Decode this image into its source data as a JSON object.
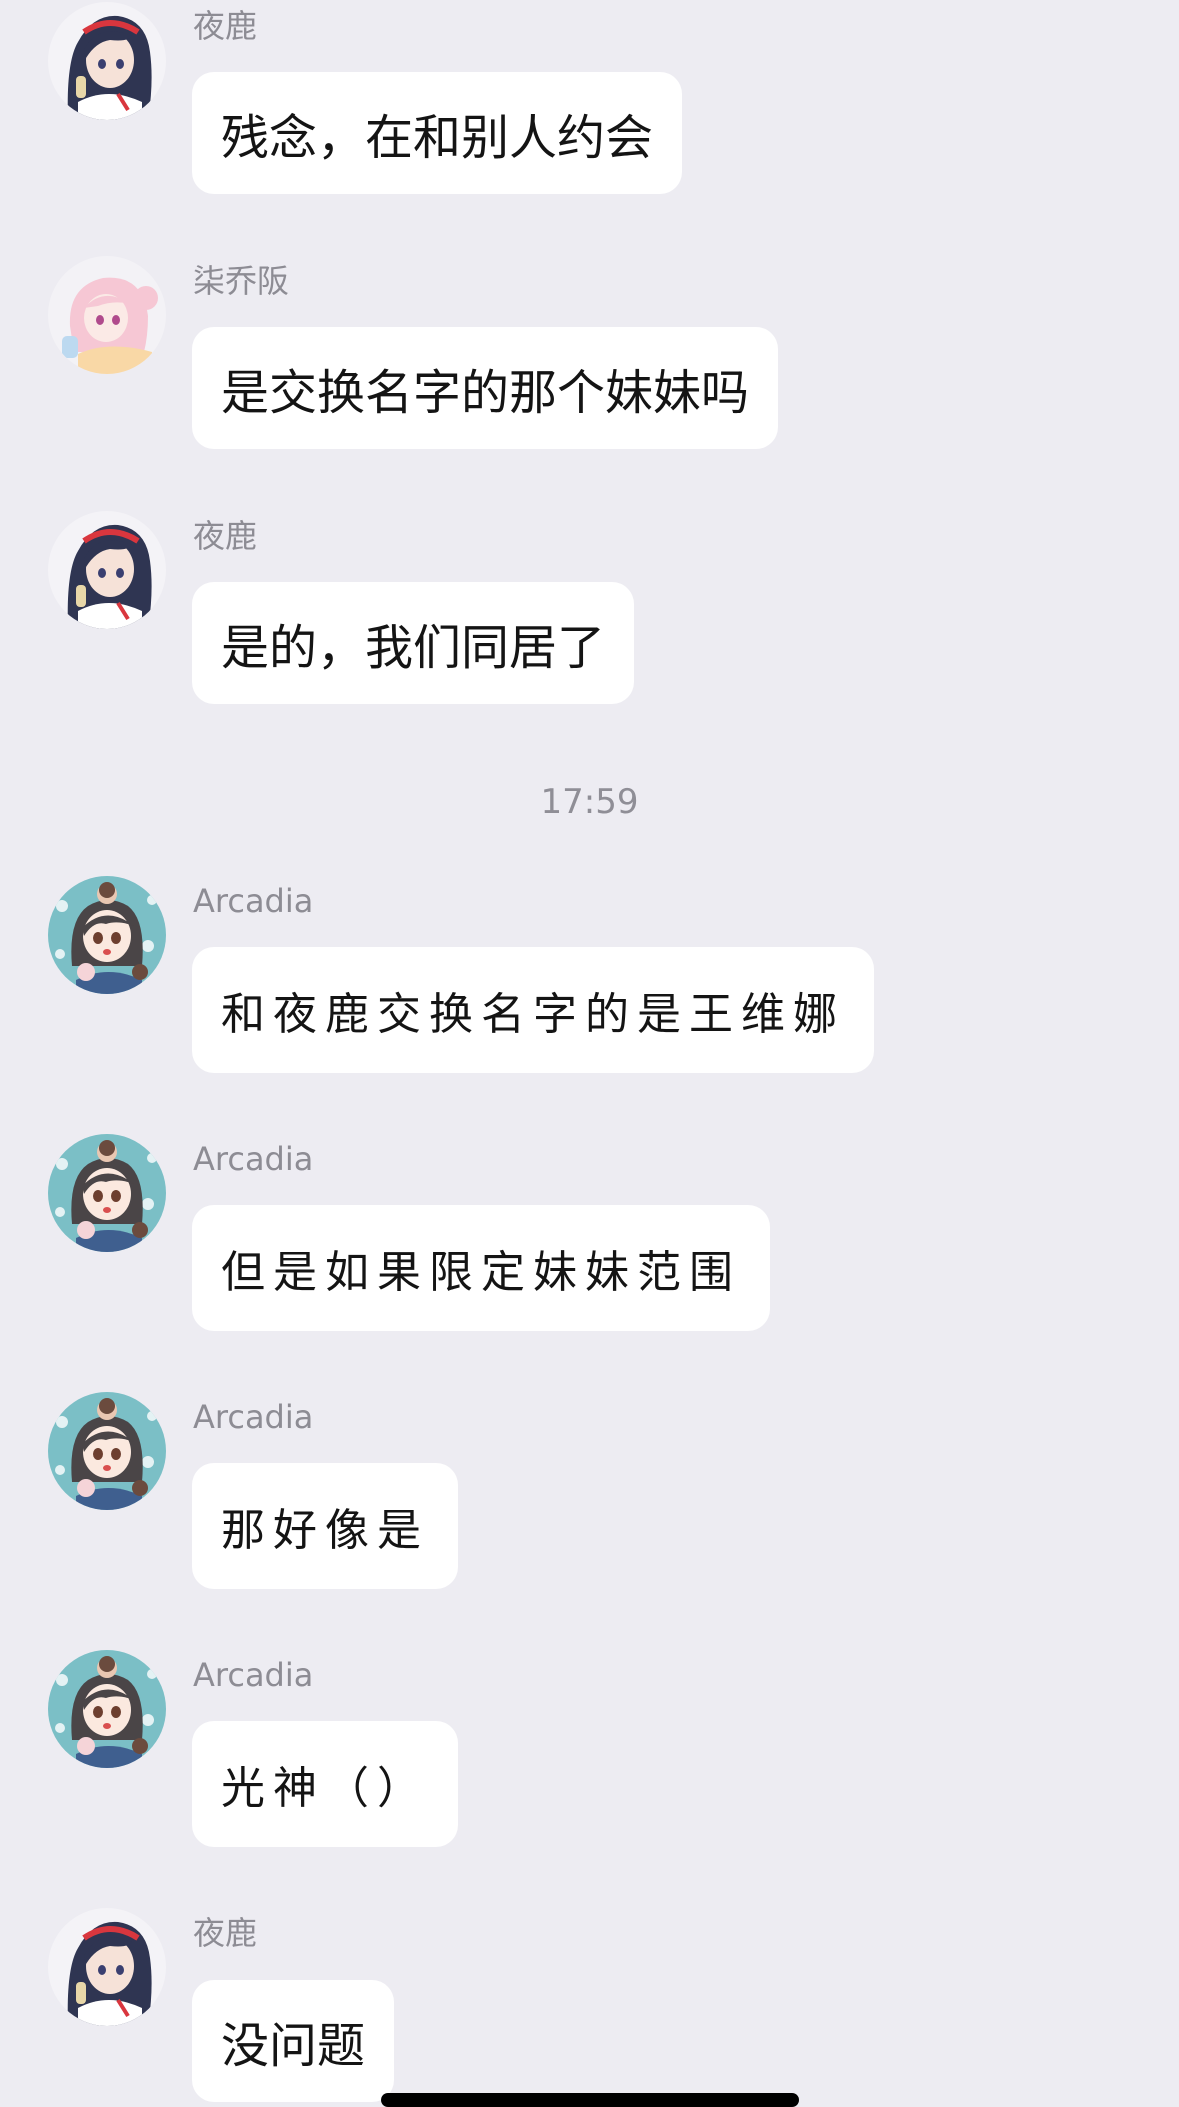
{
  "colors": {
    "background": "#edecf2",
    "bubble": "#ffffff",
    "sender_name": "#8d8c94",
    "message_text": "#141414",
    "timestamp": "#8f8e96"
  },
  "timestamp": "17:59",
  "messages": [
    {
      "sender": "夜鹿",
      "text": "残念，在和别人约会",
      "avatar": "avatar-yelu"
    },
    {
      "sender": "柒乔阪",
      "text": "是交换名字的那个妹妹吗",
      "avatar": "avatar-qiqiaoban"
    },
    {
      "sender": "夜鹿",
      "text": "是的，我们同居了",
      "avatar": "avatar-yelu"
    },
    {
      "sender": "Arcadia",
      "text": "和夜鹿交换名字的是王维娜",
      "avatar": "avatar-arcadia"
    },
    {
      "sender": "Arcadia",
      "text": "但是如果限定妹妹范围",
      "avatar": "avatar-arcadia"
    },
    {
      "sender": "Arcadia",
      "text": "那好像是",
      "avatar": "avatar-arcadia"
    },
    {
      "sender": "Arcadia",
      "text": "光神（）",
      "avatar": "avatar-arcadia"
    },
    {
      "sender": "夜鹿",
      "text": "没问题",
      "avatar": "avatar-yelu"
    }
  ]
}
